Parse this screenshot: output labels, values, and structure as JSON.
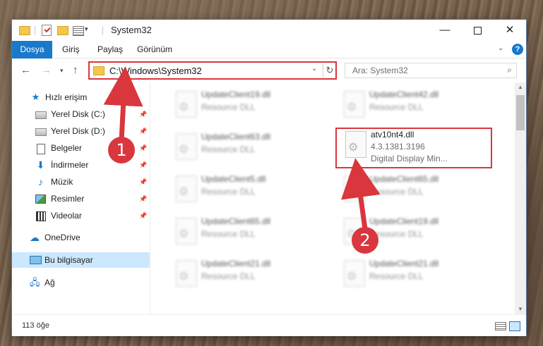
{
  "window": {
    "title": "System32",
    "status_count": "113 öğe"
  },
  "ribbon": {
    "tabs": [
      "Dosya",
      "Giriş",
      "Paylaş",
      "Görünüm"
    ],
    "help": "?"
  },
  "address": {
    "path": "C:\\Windows\\System32",
    "search_placeholder": "Ara: System32"
  },
  "sidebar": {
    "items": [
      {
        "label": "Hızlı erişim",
        "icon": "star-icon"
      },
      {
        "label": "Yerel Disk (C:)",
        "icon": "drive-icon",
        "pinned": true
      },
      {
        "label": "Yerel Disk (D:)",
        "icon": "drive-icon",
        "pinned": true
      },
      {
        "label": "Belgeler",
        "icon": "documents-icon",
        "pinned": true
      },
      {
        "label": "İndirmeler",
        "icon": "downloads-icon",
        "pinned": true
      },
      {
        "label": "Müzik",
        "icon": "music-icon",
        "pinned": true
      },
      {
        "label": "Resimler",
        "icon": "pictures-icon",
        "pinned": true
      },
      {
        "label": "Videolar",
        "icon": "videos-icon",
        "pinned": true
      },
      {
        "label": "OneDrive",
        "icon": "cloud-icon"
      },
      {
        "label": "Bu bilgisayar",
        "icon": "computer-icon",
        "selected": true
      },
      {
        "label": "Ağ",
        "icon": "network-icon"
      }
    ]
  },
  "files": {
    "left": [
      {
        "name": "UpdateClient19.dll",
        "desc": "Resource DLL"
      },
      {
        "name": "UpdateClient63.dll",
        "desc": "Resource DLL"
      },
      {
        "name": "UpdateClient5.dll",
        "desc": "Resource DLL"
      },
      {
        "name": "UpdateClient65.dll",
        "desc": "Resource DLL"
      },
      {
        "name": "UpdateClient21.dll",
        "desc": "Resource DLL"
      }
    ],
    "right": [
      {
        "name": "UpdateClient42.dll",
        "desc": "Resource DLL"
      },
      {
        "name": "UpdateClient65.dll",
        "desc": "Resource DLL"
      },
      {
        "name": "UpdateClient19.dll",
        "desc": "Resource DLL"
      },
      {
        "name": "UpdateClient21.dll",
        "desc": "Resource DLL"
      }
    ],
    "highlighted": {
      "name": "atv10nt4.dll",
      "version": "4.3.1381.3196",
      "desc": "Digital Display Min..."
    }
  },
  "annotations": {
    "step1": "1",
    "step2": "2"
  },
  "colors": {
    "accent": "#1979ca",
    "highlight": "#d9363e",
    "selected_bg": "#cce8ff"
  }
}
